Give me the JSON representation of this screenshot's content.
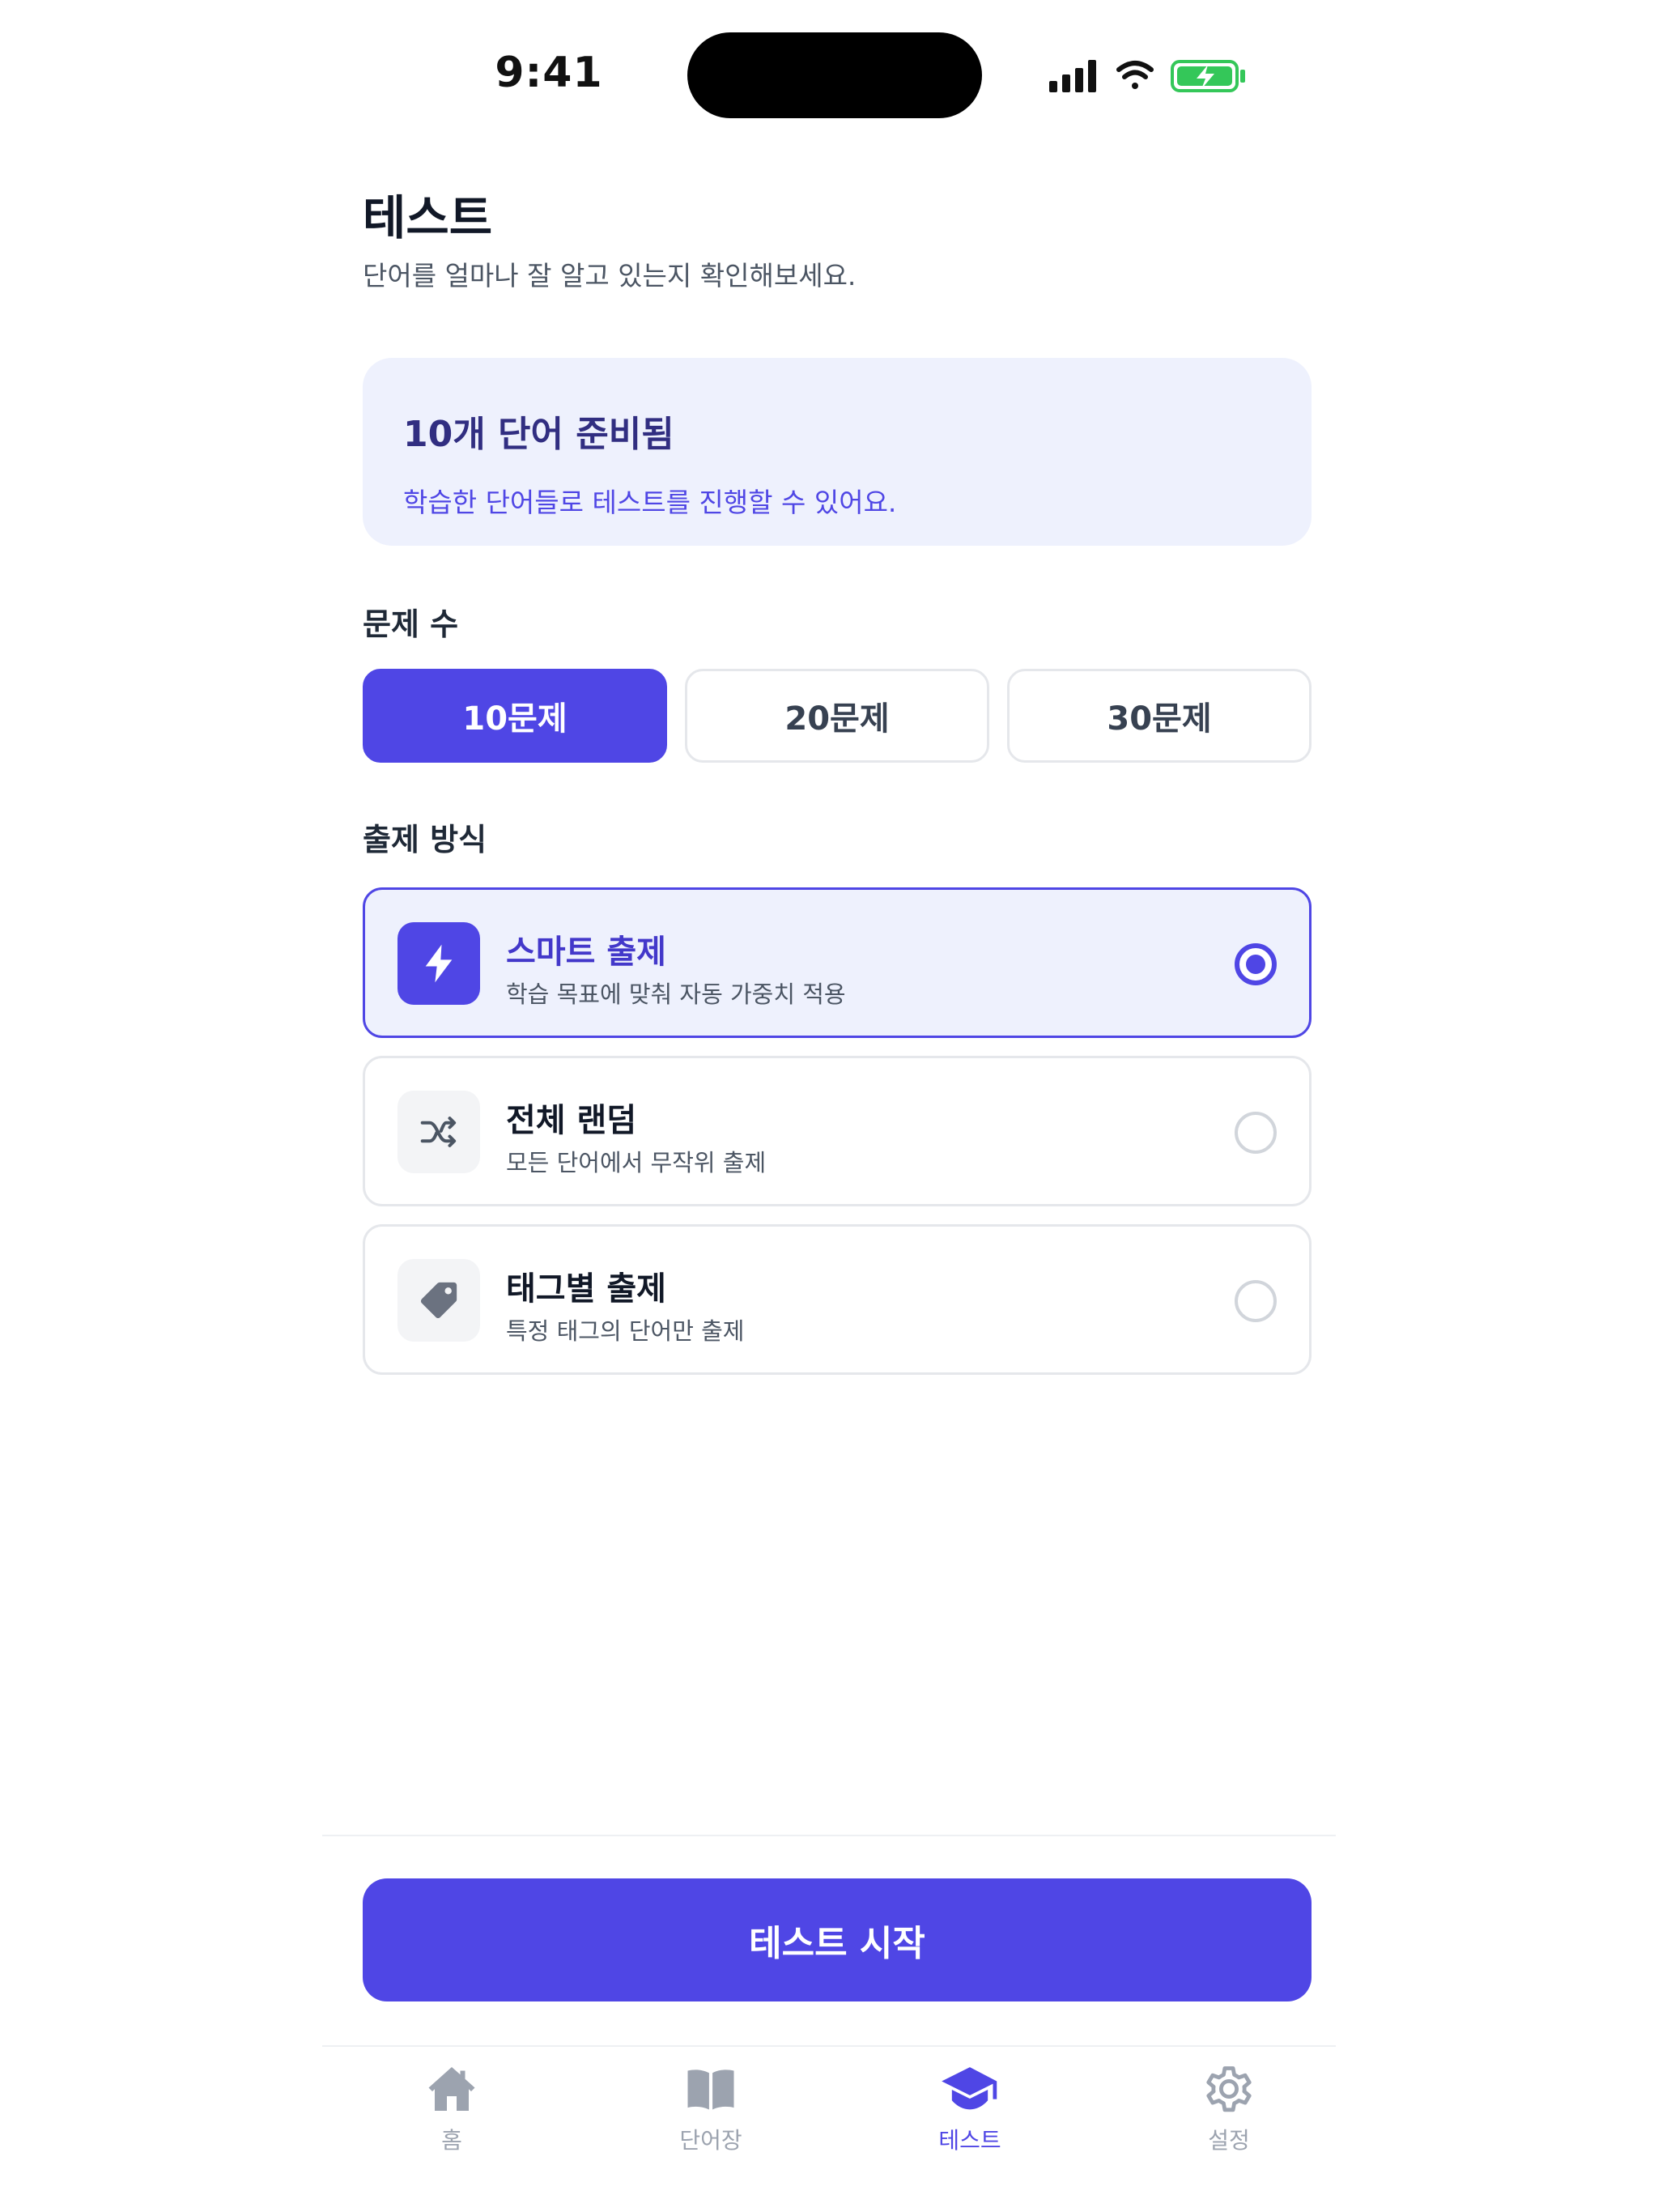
{
  "status_bar": {
    "time": "9:41"
  },
  "header": {
    "title": "테스트",
    "subtitle": "단어를 얼마나 잘 알고 있는지 확인해보세요."
  },
  "info_card": {
    "title": "10개 단어 준비됨",
    "description": "학습한 단어들로 테스트를 진행할 수 있어요."
  },
  "question_count": {
    "label": "문제 수",
    "options": [
      "10문제",
      "20문제",
      "30문제"
    ],
    "selected": "10문제"
  },
  "mode": {
    "label": "출제 방식",
    "options": [
      {
        "title": "스마트 출제",
        "description": "학습 목표에 맞춰 자동 가중치 적용",
        "icon": "lightning-icon",
        "selected": true
      },
      {
        "title": "전체 랜덤",
        "description": "모든 단어에서 무작위 출제",
        "icon": "shuffle-icon",
        "selected": false
      },
      {
        "title": "태그별 출제",
        "description": "특정 태그의 단어만 출제",
        "icon": "tag-icon",
        "selected": false
      }
    ]
  },
  "start_button": {
    "label": "테스트 시작"
  },
  "tabbar": {
    "items": [
      {
        "label": "홈",
        "icon": "home-icon",
        "active": false
      },
      {
        "label": "단어장",
        "icon": "book-icon",
        "active": false
      },
      {
        "label": "테스트",
        "icon": "graduation-cap-icon",
        "active": true
      },
      {
        "label": "설정",
        "icon": "gear-icon",
        "active": false
      }
    ]
  },
  "colors": {
    "accent": "#4f46e5",
    "accent_light": "#eef1fd",
    "inactive": "#9ca3af"
  }
}
